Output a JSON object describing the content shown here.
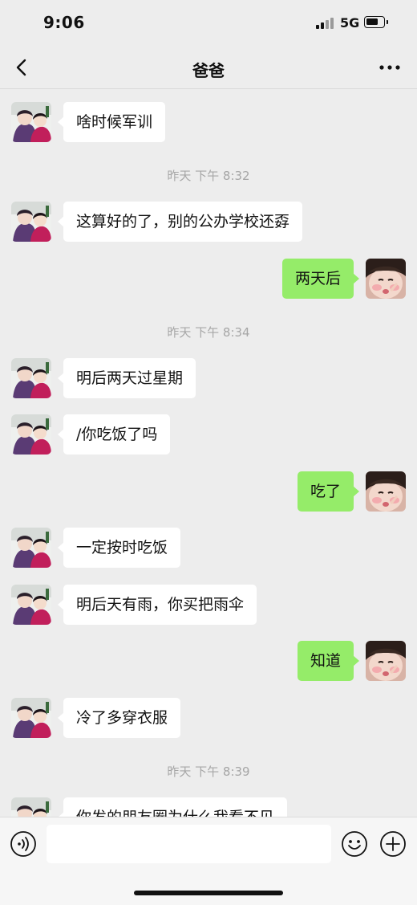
{
  "status_bar": {
    "time": "9:06",
    "network": "5G"
  },
  "header": {
    "title": "爸爸"
  },
  "messages": [
    {
      "side": "left",
      "text": "啥时候军训"
    },
    {
      "type": "timestamp",
      "text": "昨天 下午 8:32"
    },
    {
      "side": "left",
      "text": "这算好的了，别的公办学校还孬"
    },
    {
      "side": "right",
      "text": "两天后"
    },
    {
      "type": "timestamp",
      "text": "昨天 下午 8:34"
    },
    {
      "side": "left",
      "text": "明后两天过星期"
    },
    {
      "side": "left",
      "text": "/你吃饭了吗"
    },
    {
      "side": "right",
      "text": "吃了"
    },
    {
      "side": "left",
      "text": "一定按时吃饭"
    },
    {
      "side": "left",
      "text": "明后天有雨，你买把雨伞"
    },
    {
      "side": "right",
      "text": "知道"
    },
    {
      "side": "left",
      "text": "冷了多穿衣服"
    },
    {
      "type": "timestamp",
      "text": "昨天 下午 8:39"
    },
    {
      "side": "left",
      "text": "你发的朋友圈为什么我看不见"
    }
  ],
  "input": {
    "value": "",
    "placeholder": ""
  },
  "icons": {
    "back": "chevron-left-icon",
    "more": "more-dots-icon",
    "voice": "voice-icon",
    "emoji": "emoji-icon",
    "plus": "plus-icon"
  },
  "colors": {
    "background": "#ededed",
    "sent_bubble": "#95ec69",
    "received_bubble": "#ffffff",
    "timestamp_text": "#a6a6a6"
  }
}
